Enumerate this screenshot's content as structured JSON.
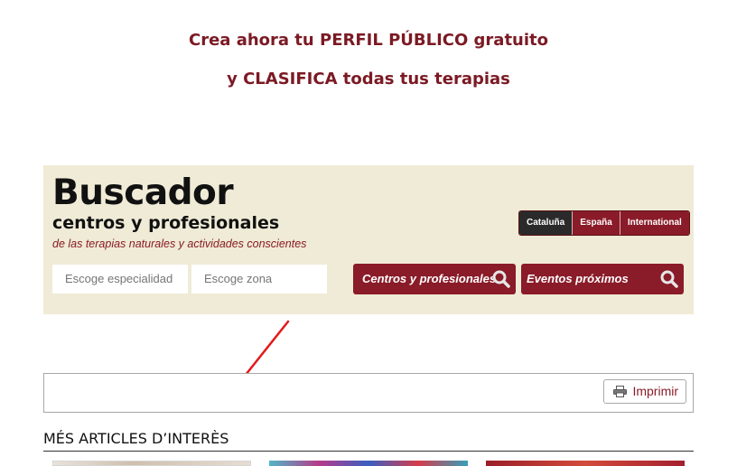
{
  "promo": {
    "line1": "Crea ahora tu PERFIL PÚBLICO gratuito",
    "line2": "y CLASIFICA todas tus terapias"
  },
  "search": {
    "title": "Buscador",
    "subtitle": "centros y profesionales",
    "tagline": "de las terapias naturales y actividades conscientes",
    "regions": [
      {
        "label": "Cataluña",
        "active": true
      },
      {
        "label": "España",
        "active": false
      },
      {
        "label": "International",
        "active": false
      }
    ],
    "especialidad_placeholder": "Escoge especialidad",
    "zona_placeholder": "Escoge zona",
    "centros_button": "Centros y profesionales",
    "eventos_button": "Eventos próximos"
  },
  "toolbar": {
    "print_label": "Imprimir"
  },
  "articles": {
    "heading": "MÉS ARTICLES D’INTERÈS"
  },
  "colors": {
    "brand": "#8a1b28",
    "panel": "#efebd6",
    "arrow": "#e3191c"
  },
  "icons": [
    "search-icon",
    "printer-icon",
    "arrow-annotation"
  ]
}
